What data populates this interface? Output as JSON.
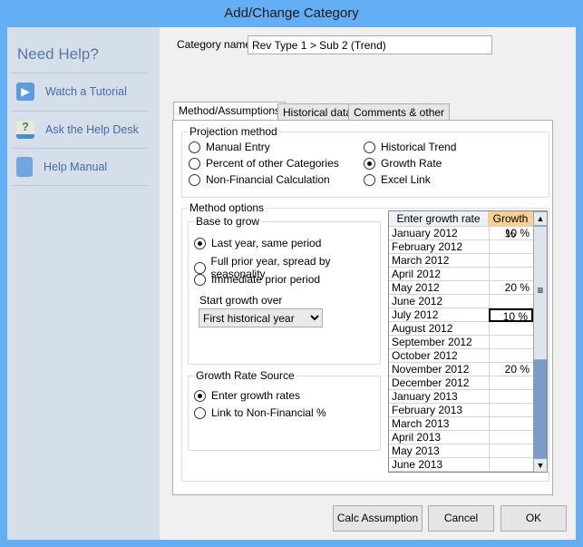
{
  "window": {
    "title": "Add/Change Category"
  },
  "sidebar": {
    "heading": "Need Help?",
    "items": [
      {
        "label": "Watch a Tutorial",
        "icon": "play-icon"
      },
      {
        "label": "Ask the Help Desk",
        "icon": "help-desk-icon"
      },
      {
        "label": "Help Manual",
        "icon": "book-icon"
      }
    ]
  },
  "category": {
    "label": "Category name",
    "value": "Rev Type 1 > Sub 2 (Trend)"
  },
  "tabs": [
    {
      "label": "Method/Assumptions",
      "active": true
    },
    {
      "label": "Historical data"
    },
    {
      "label": "Comments & other"
    }
  ],
  "projection": {
    "title": "Projection method",
    "options": [
      {
        "label": "Manual Entry"
      },
      {
        "label": "Percent of other Categories"
      },
      {
        "label": "Non-Financial Calculation"
      },
      {
        "label": "Historical Trend"
      },
      {
        "label": "Growth Rate",
        "selected": true
      },
      {
        "label": "Excel Link"
      }
    ]
  },
  "method_options": {
    "title": "Method options",
    "base": {
      "title": "Base to grow",
      "options": [
        {
          "label": "Last year, same period",
          "selected": true
        },
        {
          "label": "Full prior year, spread by seasonality"
        },
        {
          "label": "Immediate prior period"
        }
      ],
      "start_label": "Start growth over",
      "start_value": "First historical year"
    },
    "source": {
      "title": "Growth Rate Source",
      "options": [
        {
          "label": "Enter growth rates",
          "selected": true
        },
        {
          "label": "Link to Non-Financial %"
        }
      ]
    }
  },
  "grid": {
    "headers": [
      "Enter growth rate",
      "Growth %"
    ],
    "rows": [
      [
        "January  2012",
        "10 %"
      ],
      [
        "February  2012",
        ""
      ],
      [
        "March  2012",
        ""
      ],
      [
        "April  2012",
        ""
      ],
      [
        "May  2012",
        "20 %"
      ],
      [
        "June  2012",
        ""
      ],
      [
        "July  2012",
        "10 %"
      ],
      [
        "August  2012",
        ""
      ],
      [
        "September  2012",
        ""
      ],
      [
        "October  2012",
        ""
      ],
      [
        "November  2012",
        "20 %"
      ],
      [
        "December  2012",
        ""
      ],
      [
        "January  2013",
        ""
      ],
      [
        "February  2013",
        ""
      ],
      [
        "March  2013",
        ""
      ],
      [
        "April  2013",
        ""
      ],
      [
        "May  2013",
        ""
      ],
      [
        "June  2013",
        ""
      ]
    ],
    "selected_row": 6
  },
  "buttons": {
    "calc": "Calc Assumption",
    "cancel": "Cancel",
    "ok": "OK"
  }
}
